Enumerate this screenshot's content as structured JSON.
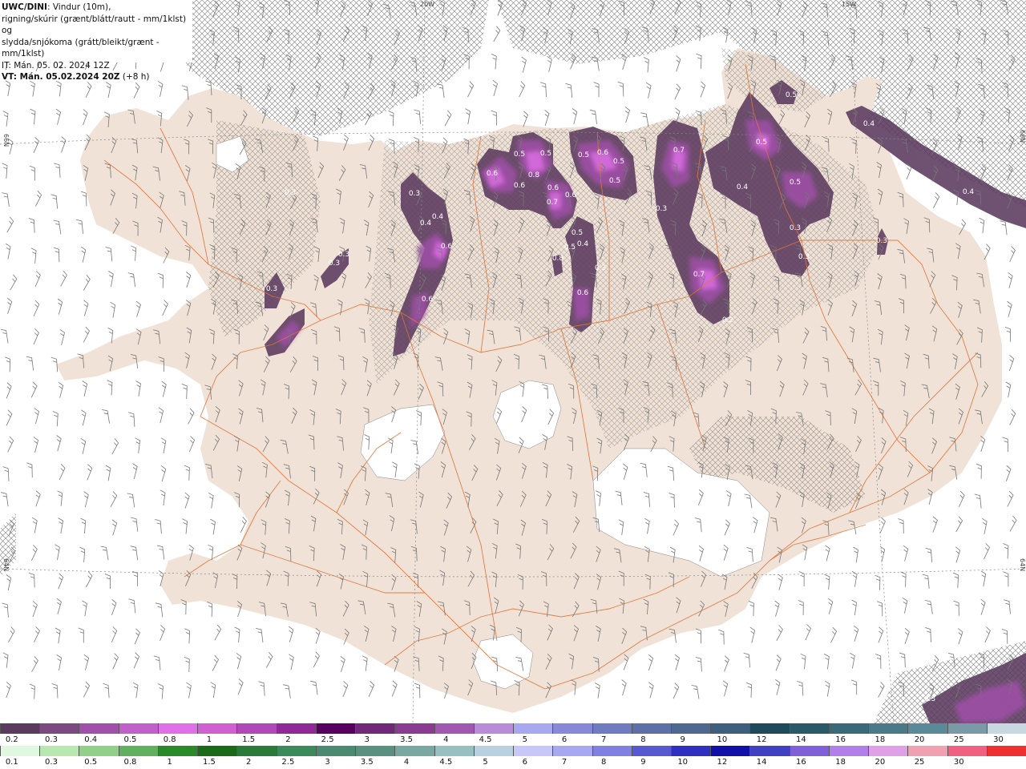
{
  "title": {
    "model": "UWC/DINI",
    "line1_rest": ": Vindur (10m),",
    "line2": "rigning/skúrir (grænt/blátt/rautt - mm/1klst) og",
    "line3": "slydda/snjókoma (grátt/bleikt/grænt - mm/1klst)",
    "line4": "IT: Mán. 05. 02. 2024 12Z",
    "line5_bold": "VT: Mán. 05.02.2024 20Z",
    "line5_rest": " (+8 h)"
  },
  "graticule": {
    "lon_labels": [
      "20W",
      "15W"
    ],
    "lat_labels": [
      "66N",
      "64N",
      "66N",
      "64N"
    ]
  },
  "precip_labels": [
    "0.3",
    "0.4",
    "0.4",
    "0.6",
    "0.6",
    "0.3",
    "0.3",
    "0.3",
    "0.3",
    "0.5",
    "0.5",
    "0.6",
    "0.8",
    "0.6",
    "0.5",
    "0.6",
    "0.5",
    "0.5",
    "0.6",
    "0.7",
    "0.6",
    "0.5",
    "0.4",
    "0.5",
    "0.8",
    "0.3",
    "0.6",
    "0.7",
    "0.4",
    "0.5",
    "0.5",
    "0.3",
    "0.3",
    "0.3",
    "0.7",
    "0.2",
    "0.5",
    "0.4",
    "0.3",
    "0.4",
    "0.3"
  ],
  "legend": {
    "snow_colors": [
      "#5b3a5e",
      "#7b4a80",
      "#a050a8",
      "#c060c8",
      "#e070e8",
      "#d060d0",
      "#b048b8",
      "#902898",
      "#580060",
      "#702878",
      "#8a3c92",
      "#a058b0",
      "#b88cd8",
      "#a8a8f0",
      "#8888d8",
      "#6f7cc0",
      "#5f6fa8",
      "#4f6890",
      "#3f5f7f",
      "#1f4a5a",
      "#2a5a68",
      "#3a6a78",
      "#4a7a88",
      "#5a8a98",
      "#7a9aa8",
      "#c8d8e0"
    ],
    "snow_labels": [
      "0.2",
      "0.3",
      "0.4",
      "0.5",
      "0.8",
      "1",
      "1.5",
      "2",
      "2.5",
      "3",
      "3.5",
      "4",
      "4.5",
      "5",
      "6",
      "7",
      "8",
      "9",
      "10",
      "12",
      "14",
      "16",
      "18",
      "20",
      "25",
      "30"
    ],
    "rain_colors": [
      "#e0f8e0",
      "#b8e8b0",
      "#90d088",
      "#60b060",
      "#2a8a2a",
      "#1a6a1a",
      "#2a7a3a",
      "#3a8a5a",
      "#4a8a70",
      "#5a9080",
      "#78a8a0",
      "#98c0c0",
      "#b8d0e0",
      "#c8c8f8",
      "#a8a8f0",
      "#8080e0",
      "#5858d0",
      "#3030c0",
      "#1010a8",
      "#4040c0",
      "#8060d8",
      "#b080e8",
      "#e0a0e8",
      "#f0a0b0",
      "#f06080",
      "#f03030"
    ],
    "rain_labels": [
      "0.1",
      "0.3",
      "0.5",
      "0.8",
      "1",
      "1.5",
      "2",
      "2.5",
      "3",
      "3.5",
      "4",
      "4.5",
      "5",
      "6",
      "7",
      "8",
      "9",
      "10",
      "12",
      "14",
      "16",
      "18",
      "20",
      "25",
      "30"
    ]
  }
}
